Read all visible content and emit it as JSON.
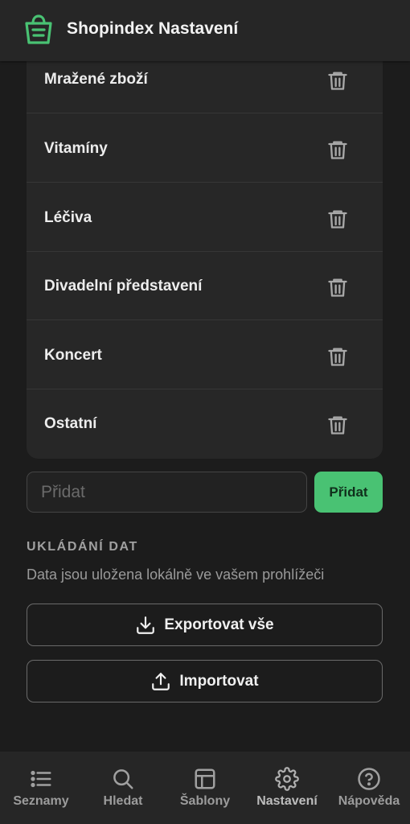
{
  "header": {
    "brand": "Shopindex",
    "title": "Nastavení",
    "logo_icon": "shopping-bag-icon",
    "accent_color": "#49c273"
  },
  "categories": {
    "items": [
      {
        "label": "Mražené zboží"
      },
      {
        "label": "Vitamíny"
      },
      {
        "label": "Léčiva"
      },
      {
        "label": "Divadelní představení"
      },
      {
        "label": "Koncert"
      },
      {
        "label": "Ostatní"
      }
    ],
    "delete_icon": "trash-icon"
  },
  "add_form": {
    "input_placeholder": "Přidat",
    "input_value": "",
    "button_label": "Přidat"
  },
  "data_storage": {
    "heading": "UKLÁDÁNÍ DAT",
    "description": "Data jsou uložena lokálně ve vašem prohlížeči",
    "export_label": "Exportovat vše",
    "export_icon": "download-icon",
    "import_label": "Importovat",
    "import_icon": "upload-icon"
  },
  "bottom_nav": {
    "items": [
      {
        "label": "Seznamy",
        "icon": "list-icon"
      },
      {
        "label": "Hledat",
        "icon": "search-icon"
      },
      {
        "label": "Šablony",
        "icon": "template-icon"
      },
      {
        "label": "Nastavení",
        "icon": "gear-icon"
      },
      {
        "label": "Nápověda",
        "icon": "help-icon"
      }
    ]
  }
}
